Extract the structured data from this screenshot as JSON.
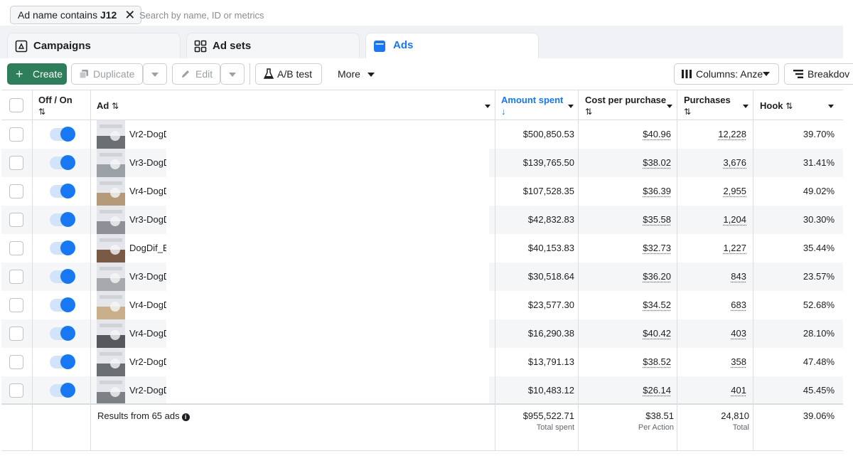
{
  "filter": {
    "prefix": "Ad name contains ",
    "value": "J12",
    "search_placeholder": "Search by name, ID or metrics"
  },
  "tabs": [
    {
      "label": "Campaigns",
      "icon": "campaign-icon"
    },
    {
      "label": "Ad sets",
      "icon": "grid-icon"
    },
    {
      "label": "Ads",
      "icon": "ads-icon"
    }
  ],
  "toolbar": {
    "create": "Create",
    "duplicate": "Duplicate",
    "edit": "Edit",
    "ab_test": "A/B test",
    "more": "More",
    "columns": "Columns: Anze",
    "breakdown": "Breakdov"
  },
  "table": {
    "headers": {
      "off_on": "Off / On",
      "ad": "Ad",
      "amount_spent": "Amount spent",
      "cost_per_purchase": "Cost per purchase",
      "purchases": "Purchases",
      "hook": "Hook"
    },
    "rows": [
      {
        "name": "Vr2-DogD",
        "spent": "$500,850.53",
        "cpp": "$40.96",
        "purchases": "12,228",
        "hook": "39.70%"
      },
      {
        "name": "Vr3-DogD",
        "spent": "$139,765.50",
        "cpp": "$38.02",
        "purchases": "3,676",
        "hook": "31.41%"
      },
      {
        "name": "Vr4-DogD",
        "spent": "$107,528.35",
        "cpp": "$36.39",
        "purchases": "2,955",
        "hook": "49.02%"
      },
      {
        "name": "Vr3-DogD",
        "spent": "$42,832.83",
        "cpp": "$35.58",
        "purchases": "1,204",
        "hook": "30.30%"
      },
      {
        "name": "DogDif_B",
        "spent": "$40,153.83",
        "cpp": "$32.73",
        "purchases": "1,227",
        "hook": "35.44%"
      },
      {
        "name": "Vr3-DogD",
        "spent": "$30,518.64",
        "cpp": "$36.20",
        "purchases": "843",
        "hook": "23.57%"
      },
      {
        "name": "Vr4-DogD",
        "spent": "$23,577.30",
        "cpp": "$34.52",
        "purchases": "683",
        "hook": "52.68%"
      },
      {
        "name": "Vr4-DogD",
        "spent": "$16,290.38",
        "cpp": "$40.42",
        "purchases": "403",
        "hook": "28.10%"
      },
      {
        "name": "Vr2-DogD",
        "spent": "$13,791.13",
        "cpp": "$38.52",
        "purchases": "358",
        "hook": "47.48%"
      },
      {
        "name": "Vr2-DogD",
        "spent": "$10,483.12",
        "cpp": "$26.14",
        "purchases": "401",
        "hook": "45.45%"
      }
    ],
    "footer": {
      "results": "Results from 65 ads",
      "spent": "$955,522.71",
      "spent_sub": "Total spent",
      "cpp": "$38.51",
      "cpp_sub": "Per Action",
      "purchases": "24,810",
      "purchases_sub": "Total",
      "hook": "39.06%"
    }
  },
  "colors": {
    "accent": "#1877f2",
    "create_green": "#2e7d5b",
    "toggle_track": "#d2e3fc"
  }
}
